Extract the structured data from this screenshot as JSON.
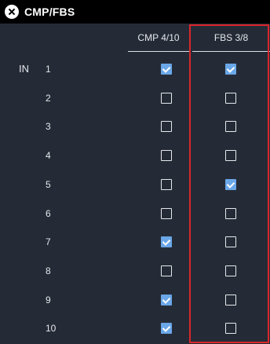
{
  "window": {
    "title": "CMP/FBS",
    "close_icon": "close-circle-icon"
  },
  "columns": {
    "cmp_label": "CMP 4/10",
    "fbs_label": "FBS 3/8"
  },
  "group_label": "IN",
  "colors": {
    "background": "#252b36",
    "titlebar": "#000000",
    "checked": "#6aa7e8",
    "highlight": "#d9262b"
  },
  "rows": [
    {
      "num": "1",
      "cmp": true,
      "fbs": true
    },
    {
      "num": "2",
      "cmp": false,
      "fbs": false
    },
    {
      "num": "3",
      "cmp": false,
      "fbs": false
    },
    {
      "num": "4",
      "cmp": false,
      "fbs": false
    },
    {
      "num": "5",
      "cmp": false,
      "fbs": true
    },
    {
      "num": "6",
      "cmp": false,
      "fbs": false
    },
    {
      "num": "7",
      "cmp": true,
      "fbs": false
    },
    {
      "num": "8",
      "cmp": false,
      "fbs": false
    },
    {
      "num": "9",
      "cmp": true,
      "fbs": false
    },
    {
      "num": "10",
      "cmp": true,
      "fbs": false
    }
  ]
}
